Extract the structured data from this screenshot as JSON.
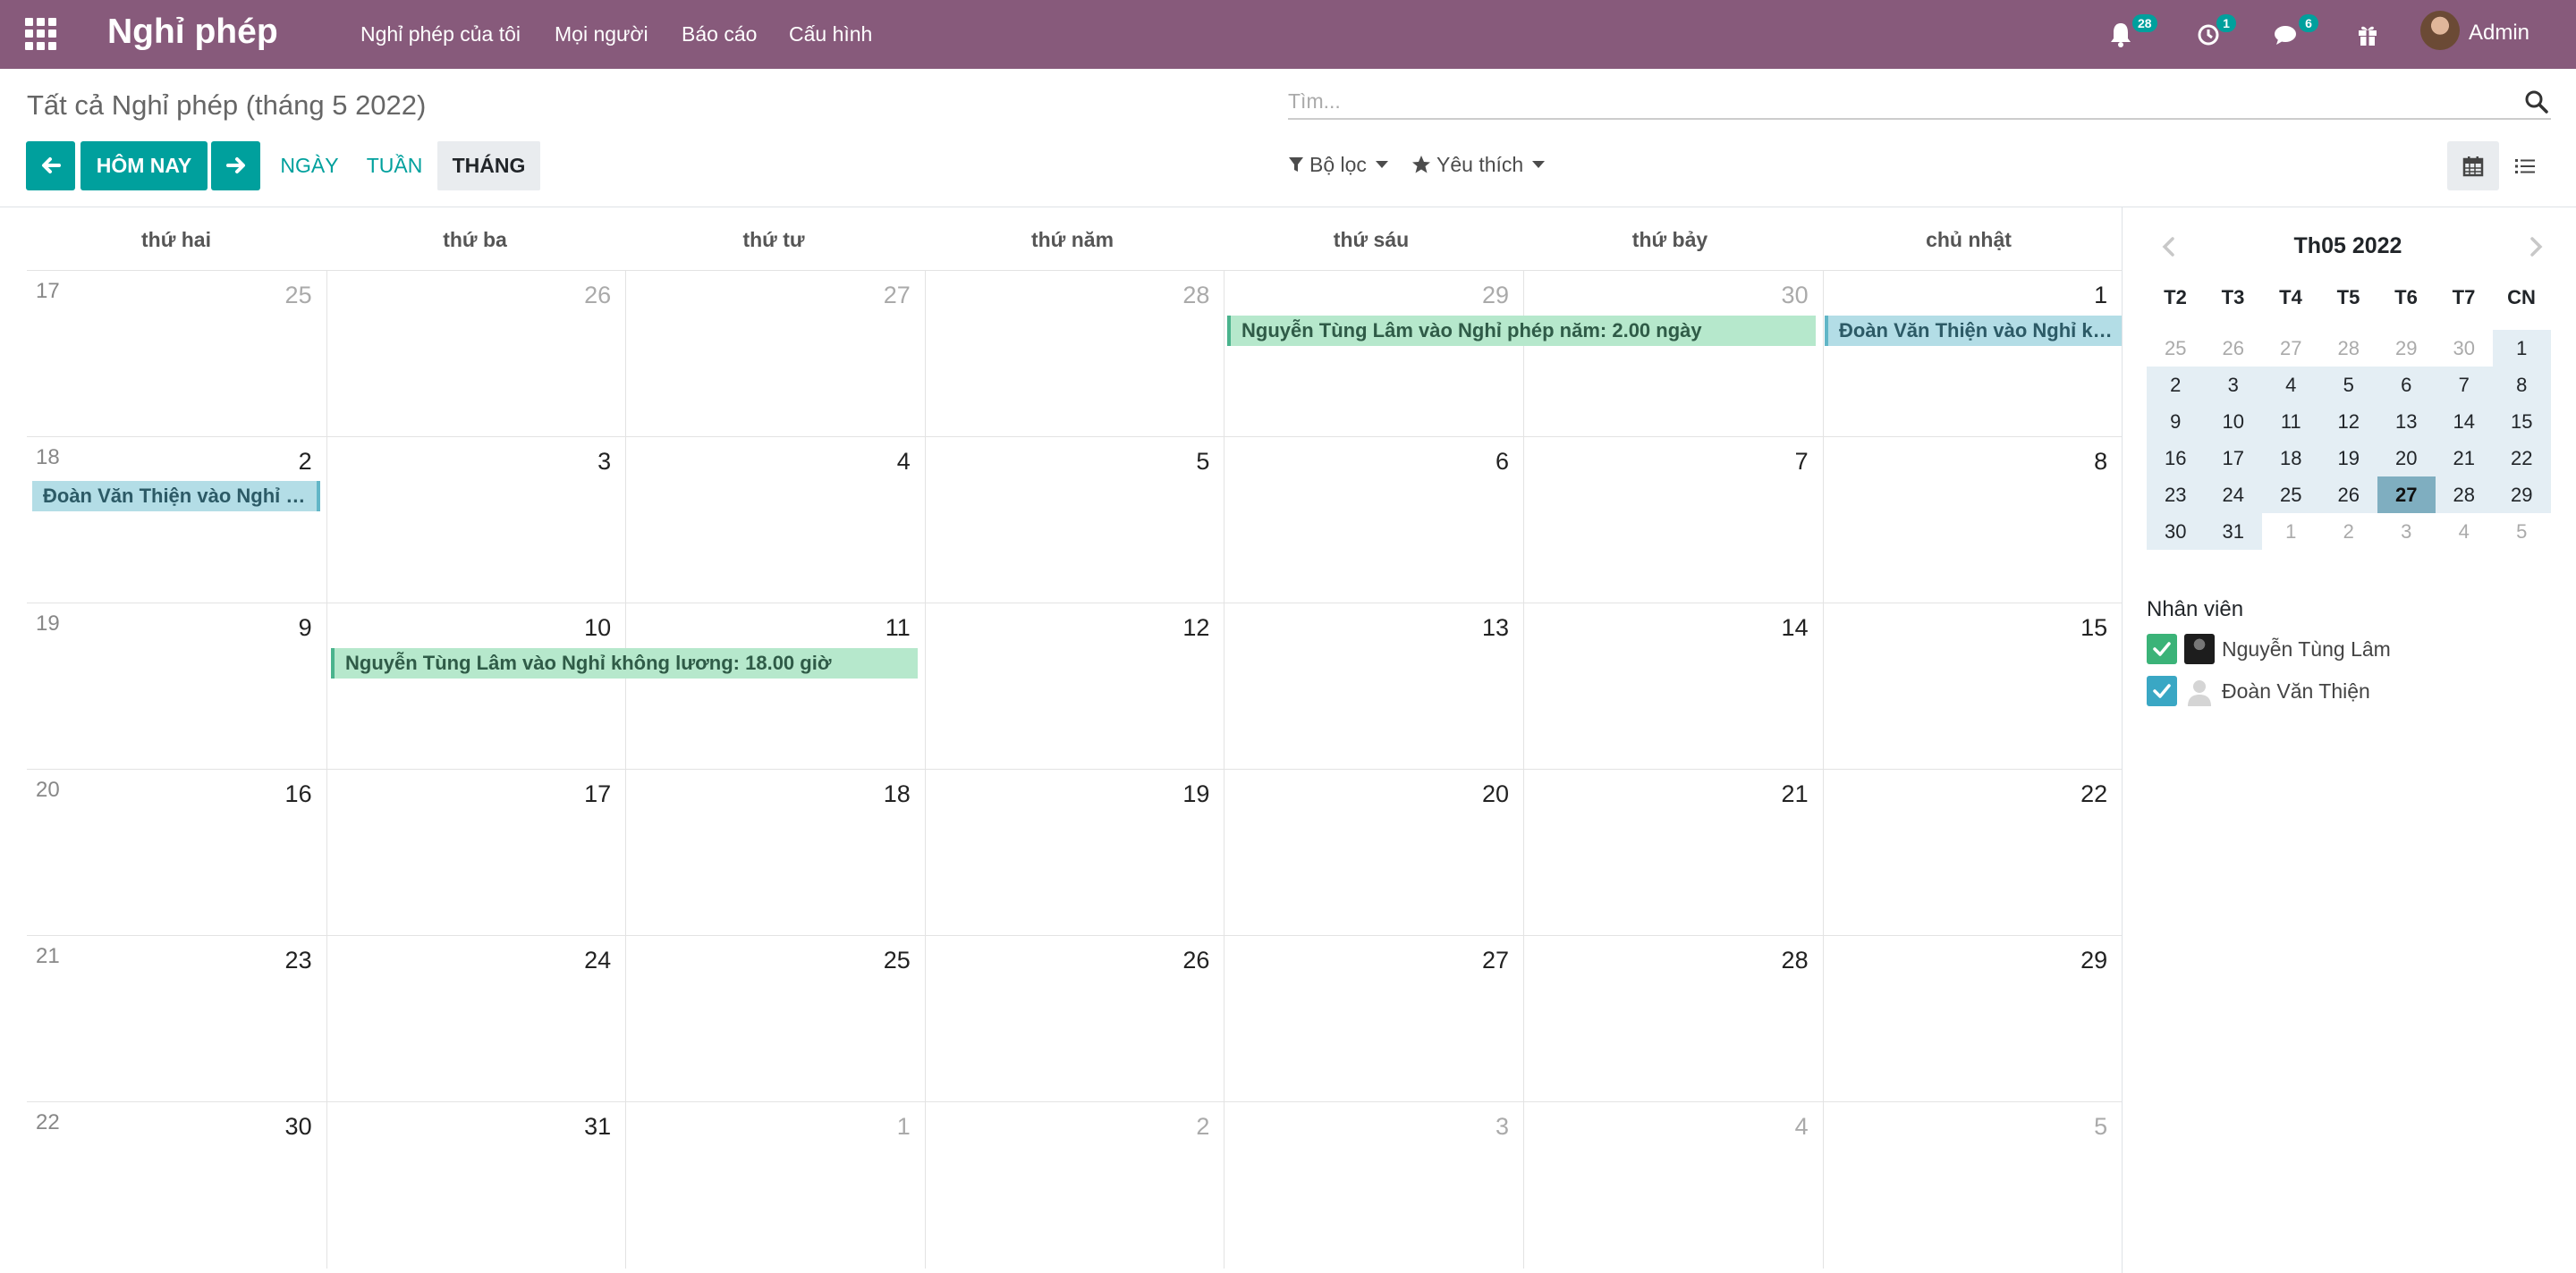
{
  "navbar": {
    "brand": "Nghỉ phép",
    "menu": [
      "Nghỉ phép của tôi",
      "Mọi người",
      "Báo cáo",
      "Cấu hình"
    ],
    "notifications_count": "28",
    "activities_count": "1",
    "messages_count": "6",
    "user_name": "Admin"
  },
  "control_panel": {
    "breadcrumb": "Tất cả Nghỉ phép (tháng 5 2022)",
    "search_placeholder": "Tìm...",
    "today_label": "HÔM NAY",
    "scale_day": "NGÀY",
    "scale_week": "TUẦN",
    "scale_month": "THÁNG",
    "filters_label": "Bộ lọc",
    "favorites_label": "Yêu thích"
  },
  "calendar": {
    "weekdays": [
      "thứ hai",
      "thứ ba",
      "thứ tư",
      "thứ năm",
      "thứ sáu",
      "thứ bảy",
      "chủ nhật"
    ],
    "weeks": [
      {
        "week": "17",
        "days": [
          {
            "d": "25",
            "m": true
          },
          {
            "d": "26",
            "m": true
          },
          {
            "d": "27",
            "m": true
          },
          {
            "d": "28",
            "m": true
          },
          {
            "d": "29",
            "m": true
          },
          {
            "d": "30",
            "m": true
          },
          {
            "d": "1",
            "m": false
          }
        ]
      },
      {
        "week": "18",
        "days": [
          {
            "d": "2",
            "m": false
          },
          {
            "d": "3",
            "m": false
          },
          {
            "d": "4",
            "m": false
          },
          {
            "d": "5",
            "m": false
          },
          {
            "d": "6",
            "m": false
          },
          {
            "d": "7",
            "m": false
          },
          {
            "d": "8",
            "m": false
          }
        ]
      },
      {
        "week": "19",
        "days": [
          {
            "d": "9",
            "m": false
          },
          {
            "d": "10",
            "m": false
          },
          {
            "d": "11",
            "m": false
          },
          {
            "d": "12",
            "m": false
          },
          {
            "d": "13",
            "m": false
          },
          {
            "d": "14",
            "m": false
          },
          {
            "d": "15",
            "m": false
          }
        ]
      },
      {
        "week": "20",
        "days": [
          {
            "d": "16",
            "m": false
          },
          {
            "d": "17",
            "m": false
          },
          {
            "d": "18",
            "m": false
          },
          {
            "d": "19",
            "m": false
          },
          {
            "d": "20",
            "m": false
          },
          {
            "d": "21",
            "m": false
          },
          {
            "d": "22",
            "m": false
          }
        ]
      },
      {
        "week": "21",
        "days": [
          {
            "d": "23",
            "m": false
          },
          {
            "d": "24",
            "m": false
          },
          {
            "d": "25",
            "m": false
          },
          {
            "d": "26",
            "m": false
          },
          {
            "d": "27",
            "m": false
          },
          {
            "d": "28",
            "m": false
          },
          {
            "d": "29",
            "m": false
          }
        ]
      },
      {
        "week": "22",
        "days": [
          {
            "d": "30",
            "m": false
          },
          {
            "d": "31",
            "m": false
          },
          {
            "d": "1",
            "m": true
          },
          {
            "d": "2",
            "m": true
          },
          {
            "d": "3",
            "m": true
          },
          {
            "d": "4",
            "m": true
          },
          {
            "d": "5",
            "m": true
          }
        ]
      }
    ],
    "events": [
      {
        "title": "Nguyễn Tùng Lâm vào Nghỉ phép năm: 2.00 ngày",
        "color": "green"
      },
      {
        "title": "Đoàn Văn Thiện vào Nghỉ kh...",
        "color": "blue"
      },
      {
        "title": "Đoàn Văn Thiện vào Nghỉ k...",
        "color": "blue"
      },
      {
        "title": "Nguyễn Tùng Lâm vào Nghỉ không lương: 18.00 giờ",
        "color": "green"
      }
    ]
  },
  "sidebar": {
    "mini_title": "Th05 2022",
    "mini_dow": [
      "T2",
      "T3",
      "T4",
      "T5",
      "T6",
      "T7",
      "CN"
    ],
    "mini_weeks": [
      [
        "25",
        "26",
        "27",
        "28",
        "29",
        "30",
        "1"
      ],
      [
        "2",
        "3",
        "4",
        "5",
        "6",
        "7",
        "8"
      ],
      [
        "9",
        "10",
        "11",
        "12",
        "13",
        "14",
        "15"
      ],
      [
        "16",
        "17",
        "18",
        "19",
        "20",
        "21",
        "22"
      ],
      [
        "23",
        "24",
        "25",
        "26",
        "27",
        "28",
        "29"
      ],
      [
        "30",
        "31",
        "1",
        "2",
        "3",
        "4",
        "5"
      ]
    ],
    "filter_title": "Nhân viên",
    "employees": [
      "Nguyễn Tùng Lâm",
      "Đoàn Văn Thiện"
    ]
  },
  "colors": {
    "brand": "#875a7b",
    "primary": "#00a09d",
    "event_green": "#b6e8cc",
    "event_blue": "#b3dde6",
    "today": "#7faec0"
  }
}
